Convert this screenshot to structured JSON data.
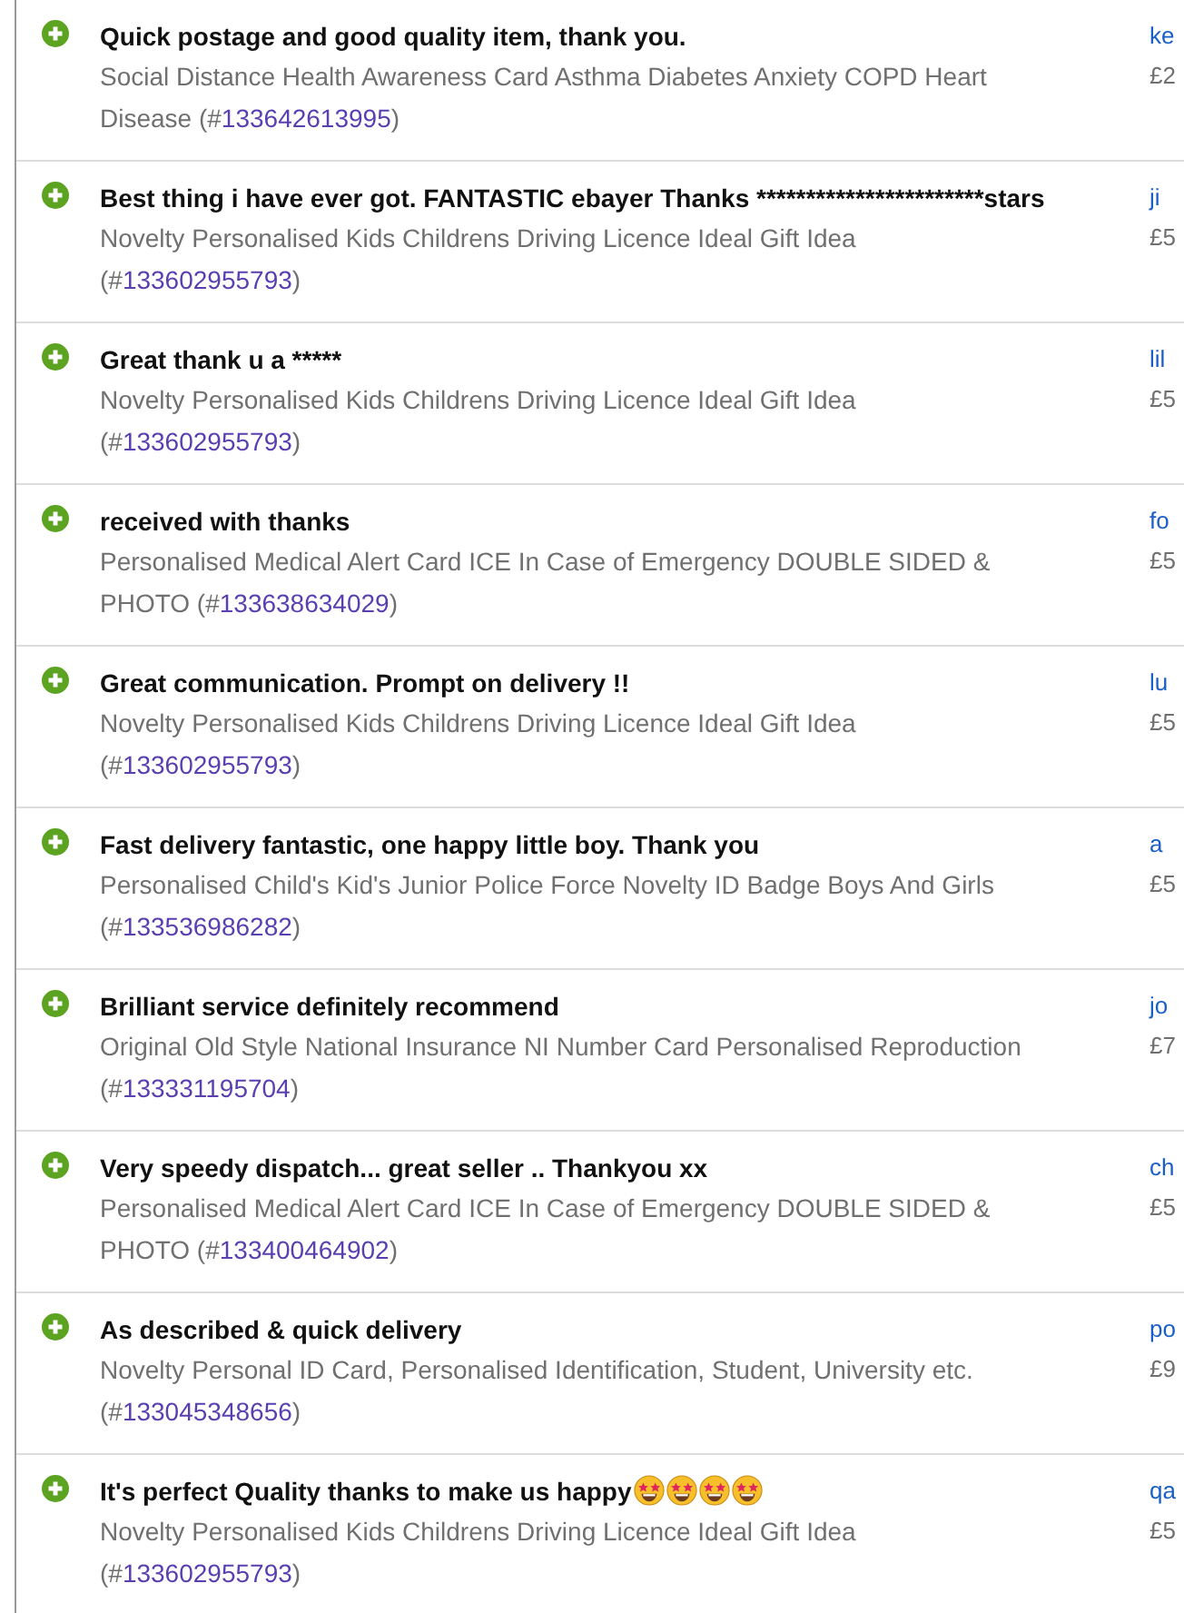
{
  "feedback": [
    {
      "kind": "positive",
      "comment": "Quick postage and good quality item, thank you.",
      "item": "Social Distance Health Awareness Card Asthma Diabetes Anxiety COPD Heart Disease (#",
      "item_number": "133642613995",
      "item_suffix": ")",
      "buyer": "ke",
      "price": "£2"
    },
    {
      "kind": "positive",
      "comment": "Best thing i have ever got. FANTASTIC ebayer Thanks ***********************stars",
      "item": "Novelty Personalised Kids Childrens Driving Licence Ideal Gift Idea (#",
      "item_number": "133602955793",
      "item_suffix": ")",
      "buyer": "ji",
      "price": "£5"
    },
    {
      "kind": "positive",
      "comment": "Great thank u a *****",
      "item": "Novelty Personalised Kids Childrens Driving Licence Ideal Gift Idea (#",
      "item_number": "133602955793",
      "item_suffix": ")",
      "buyer": "lil",
      "price": "£5"
    },
    {
      "kind": "positive",
      "comment": "received with thanks",
      "item": "Personalised Medical Alert Card ICE In Case of Emergency DOUBLE SIDED & PHOTO (#",
      "item_number": "133638634029",
      "item_suffix": ")",
      "buyer": "fo",
      "price": "£5"
    },
    {
      "kind": "positive",
      "comment": "Great communication. Prompt on delivery !!",
      "item": "Novelty Personalised Kids Childrens Driving Licence Ideal Gift Idea (#",
      "item_number": "133602955793",
      "item_suffix": ")",
      "buyer": "lu",
      "price": "£5"
    },
    {
      "kind": "positive",
      "comment": "Fast delivery fantastic, one happy little boy. Thank you",
      "item": "Personalised Child's Kid's Junior Police Force Novelty ID Badge Boys And Girls (#",
      "item_number": "133536986282",
      "item_suffix": ")",
      "buyer": "a",
      "price": "£5"
    },
    {
      "kind": "positive",
      "comment": "Brilliant service definitely recommend",
      "item": "Original Old Style National Insurance NI Number Card Personalised Reproduction (#",
      "item_number": "133331195704",
      "item_suffix": ")",
      "buyer": "jo",
      "price": "£7"
    },
    {
      "kind": "positive",
      "comment": "Very speedy dispatch... great seller .. Thankyou xx",
      "item": "Personalised Medical Alert Card ICE In Case of Emergency DOUBLE SIDED & PHOTO (#",
      "item_number": "133400464902",
      "item_suffix": ")",
      "buyer": "ch",
      "price": "£5"
    },
    {
      "kind": "positive",
      "comment": "As described & quick delivery",
      "item": "Novelty Personal ID Card, Personalised Identification, Student, University etc. (#",
      "item_number": "133045348656",
      "item_suffix": ")",
      "buyer": "po",
      "price": "£9"
    },
    {
      "kind": "positive",
      "comment": "It's perfect Quality thanks to make us happy",
      "comment_icons": [
        {
          "kind": "star_eyes"
        },
        {
          "kind": "star_eyes"
        },
        {
          "kind": "star_eyes"
        },
        {
          "kind": "star_eyes"
        }
      ],
      "item": "Novelty Personalised Kids Childrens Driving Licence Ideal Gift Idea (#",
      "item_number": "133602955793",
      "item_suffix": ")",
      "buyer": "qa",
      "price": "£5"
    }
  ]
}
